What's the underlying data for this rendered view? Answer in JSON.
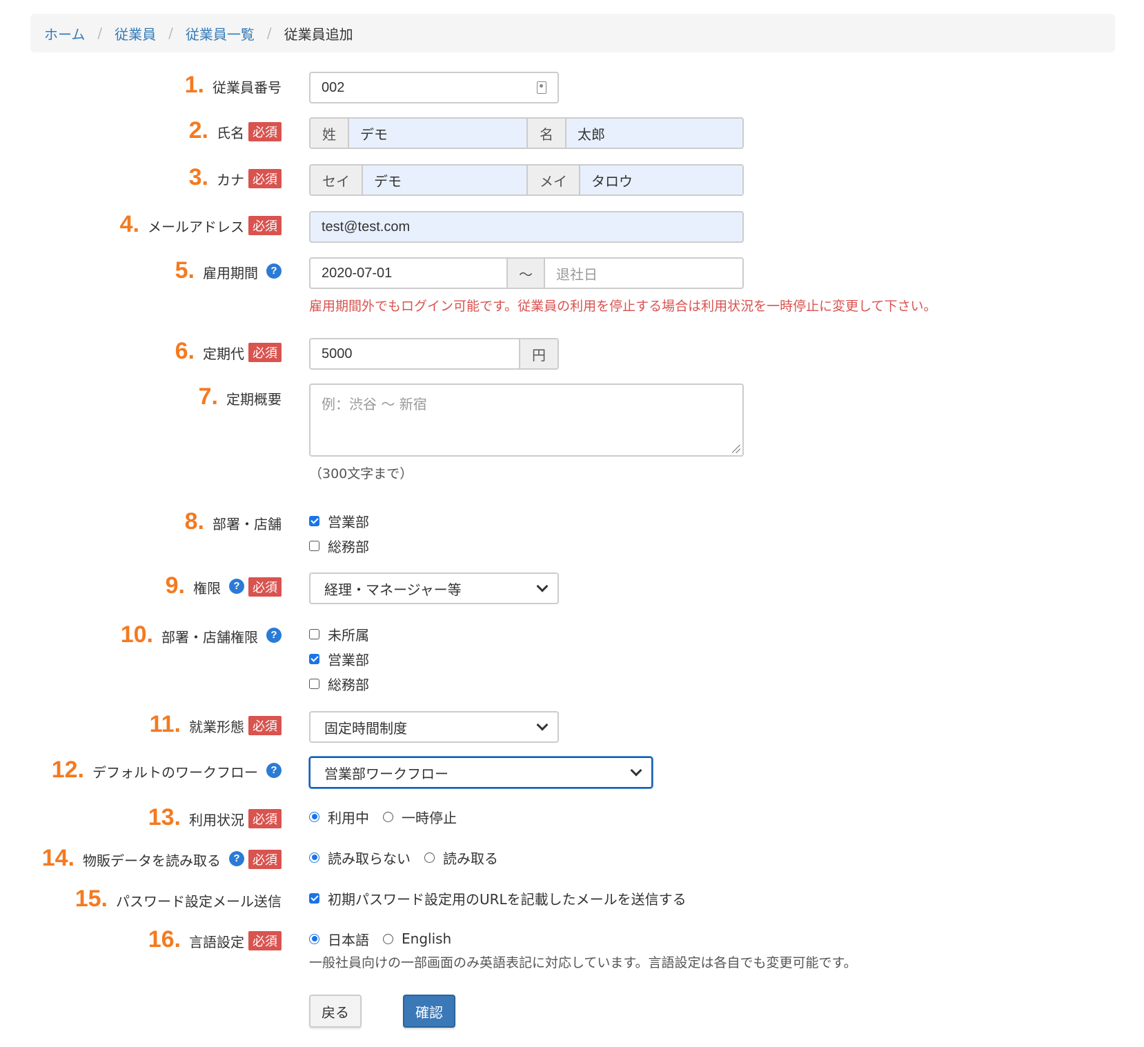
{
  "breadcrumb": {
    "items": [
      "ホーム",
      "従業員",
      "従業員一覧"
    ],
    "current": "従業員追加",
    "separator": "/"
  },
  "required_label": "必須",
  "fields": {
    "f1": {
      "num": "1.",
      "label": "従業員番号",
      "value": "002"
    },
    "f2": {
      "num": "2.",
      "label": "氏名",
      "last_addon": "姓",
      "last_value": "デモ",
      "first_addon": "名",
      "first_value": "太郎"
    },
    "f3": {
      "num": "3.",
      "label": "カナ",
      "last_addon": "セイ",
      "last_value": "デモ",
      "first_addon": "メイ",
      "first_value": "タロウ"
    },
    "f4": {
      "num": "4.",
      "label": "メールアドレス",
      "value": "test@test.com"
    },
    "f5": {
      "num": "5.",
      "label": "雇用期間",
      "start": "2020-07-01",
      "tilde": "〜",
      "end_placeholder": "退社日",
      "error": "雇用期間外でもログイン可能です。従業員の利用を停止する場合は利用状況を一時停止に変更して下さい。"
    },
    "f6": {
      "num": "6.",
      "label": "定期代",
      "value": "5000",
      "unit": "円"
    },
    "f7": {
      "num": "7.",
      "label": "定期概要",
      "placeholder": "例：渋谷 〜 新宿",
      "note": "（300文字まで）"
    },
    "f8": {
      "num": "8.",
      "label": "部署・店舗",
      "options": [
        {
          "label": "営業部",
          "checked": true
        },
        {
          "label": "総務部",
          "checked": false
        }
      ]
    },
    "f9": {
      "num": "9.",
      "label": "権限",
      "selected": "経理・マネージャー等"
    },
    "f10": {
      "num": "10.",
      "label": "部署・店舗権限",
      "options": [
        {
          "label": "未所属",
          "checked": false
        },
        {
          "label": "営業部",
          "checked": true
        },
        {
          "label": "総務部",
          "checked": false
        }
      ]
    },
    "f11": {
      "num": "11.",
      "label": "就業形態",
      "selected": "固定時間制度"
    },
    "f12": {
      "num": "12.",
      "label": "デフォルトのワークフロー",
      "selected": "営業部ワークフロー"
    },
    "f13": {
      "num": "13.",
      "label": "利用状況",
      "options": [
        {
          "label": "利用中",
          "checked": true
        },
        {
          "label": "一時停止",
          "checked": false
        }
      ]
    },
    "f14": {
      "num": "14.",
      "label": "物販データを読み取る",
      "options": [
        {
          "label": "読み取らない",
          "checked": true
        },
        {
          "label": "読み取る",
          "checked": false
        }
      ]
    },
    "f15": {
      "num": "15.",
      "label": "パスワード設定メール送信",
      "option": {
        "label": "初期パスワード設定用のURLを記載したメールを送信する",
        "checked": true
      }
    },
    "f16": {
      "num": "16.",
      "label": "言語設定",
      "options": [
        {
          "label": "日本語",
          "checked": true
        },
        {
          "label": "English",
          "checked": false
        }
      ],
      "note": "一般社員向けの一部画面のみ英語表記に対応しています。言語設定は各自でも変更可能です。"
    }
  },
  "buttons": {
    "back": "戻る",
    "confirm": "確認"
  },
  "help_icon": "?",
  "colors": {
    "accent_number": "#f47a20",
    "required_badge": "#d9534f",
    "link": "#337ab7",
    "primary_button": "#3a78b8",
    "help_icon": "#2a7bd6",
    "autofill_bg": "#e8f0fe"
  }
}
